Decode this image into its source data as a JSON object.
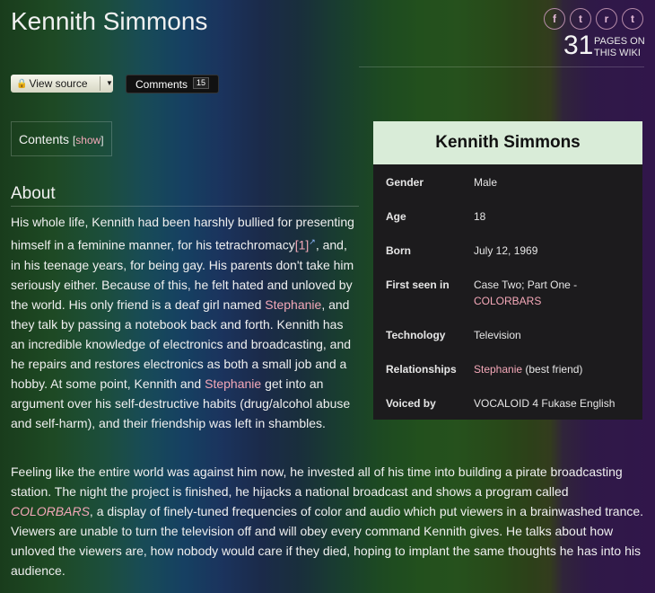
{
  "page": {
    "title": "Kennith Simmons",
    "pages_count": "31",
    "pages_label_1": "PAGES ON",
    "pages_label_2": "THIS WIKI"
  },
  "social": [
    {
      "icon": "facebook-icon",
      "glyph": "f"
    },
    {
      "icon": "twitter-icon",
      "glyph": "t"
    },
    {
      "icon": "reddit-icon",
      "glyph": "r"
    },
    {
      "icon": "tumblr-icon",
      "glyph": "t"
    }
  ],
  "toolbar": {
    "view_source_label": "View source",
    "comments_label": "Comments",
    "comments_count": "15"
  },
  "toc": {
    "label": "Contents",
    "bracket_open": "[",
    "show_label": "show",
    "bracket_close": "]"
  },
  "about": {
    "heading": "About",
    "p1": [
      {
        "t": "His whole life, Kennith had been harshly bullied for presenting himself in a feminine manner, for his tetrachromacy"
      },
      {
        "t": "[1]",
        "link": true
      },
      {
        "t": "↗",
        "ext": true
      },
      {
        "t": ", and, in his teenage years, for being gay. His parents don't take him seriously either. Because of this, he felt hated and unloved by the world. His only friend is a deaf girl named "
      },
      {
        "t": "Stephanie",
        "link": true
      },
      {
        "t": ", and they talk by passing a notebook back and forth. Kennith has an incredible knowledge of electronics and broadcasting, and he repairs and restores electronics as both a small job and a hobby. At some point, Kennith and "
      },
      {
        "t": "Stephanie",
        "link": true
      },
      {
        "t": " get into an argument over his self-destructive habits (drug/alcohol abuse and self-harm), and their friendship was left in shambles."
      }
    ],
    "p2": [
      {
        "t": "Feeling like the entire world was against him now, he invested all of his time into building a pirate broadcasting station. The night the project is finished, he hijacks a national broadcast and shows a program called "
      },
      {
        "t": "COLORBARS",
        "link": true,
        "italic": true
      },
      {
        "t": ", a display of finely-tuned frequencies of color and audio which put viewers in a brainwashed trance. Viewers are unable to turn the television off and will obey every command Kennith gives. He talks about how unloved the viewers are, how nobody would care if they died, hoping to implant the same thoughts he has into his audience."
      }
    ]
  },
  "infobox": {
    "title": "Kennith Simmons",
    "rows": [
      {
        "label": "Gender",
        "value": "Male"
      },
      {
        "label": "Age",
        "value": "18"
      },
      {
        "label": "Born",
        "value": "July 12, 1969"
      },
      {
        "label": "First seen in",
        "value": "Case Two; Part One -",
        "link": "COLORBARS"
      },
      {
        "label": "Technology",
        "value": "Television"
      },
      {
        "label": "Relationships",
        "link": "Stephanie",
        "value": " (best friend)"
      },
      {
        "label": "Voiced by",
        "value": "VOCALOID 4 Fukase English"
      }
    ]
  },
  "colors": {
    "link": "#f4a8b8",
    "infobox_header": "#d9ecd8",
    "infobox_bg": "#1c1b1d"
  }
}
